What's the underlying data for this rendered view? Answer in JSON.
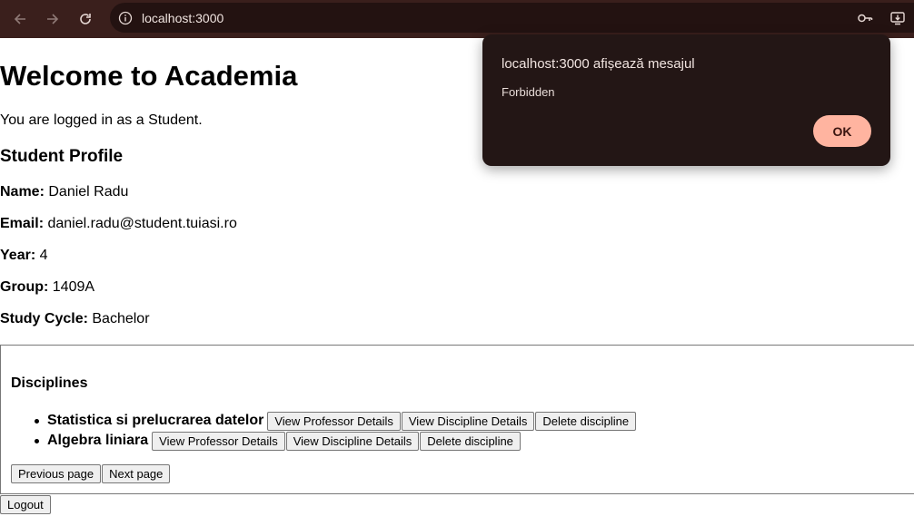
{
  "browser": {
    "url": "localhost:3000",
    "icons": [
      "back-arrow-icon",
      "forward-arrow-icon",
      "reload-icon",
      "site-info-icon",
      "password-key-icon",
      "install-app-icon"
    ]
  },
  "page": {
    "title": "Welcome to Academia",
    "role_text": "You are logged in as a Student.",
    "profile_heading": "Student Profile",
    "profile": {
      "name_label": "Name:",
      "name": "Daniel Radu",
      "email_label": "Email:",
      "email": "daniel.radu@student.tuiasi.ro",
      "year_label": "Year:",
      "year": "4",
      "group_label": "Group:",
      "group": "1409A",
      "cycle_label": "Study Cycle:",
      "cycle": "Bachelor"
    },
    "disciplines": {
      "heading": "Disciplines",
      "items": [
        {
          "name": "Statistica si prelucrarea datelor",
          "view_professor": "View Professor Details",
          "view_discipline": "View Discipline Details",
          "delete": "Delete discipline"
        },
        {
          "name": "Algebra liniara",
          "view_professor": "View Professor Details",
          "view_discipline": "View Discipline Details",
          "delete": "Delete discipline"
        }
      ],
      "prev_label": "Previous page",
      "next_label": "Next page"
    },
    "logout_label": "Logout"
  },
  "dialog": {
    "title": "localhost:3000 afișează mesajul",
    "message": "Forbidden",
    "ok_label": "OK"
  },
  "colors": {
    "toolbar_bg": "#3a1f1c",
    "dialog_bg": "#231615",
    "ok_button_bg": "#ffb4a0"
  }
}
